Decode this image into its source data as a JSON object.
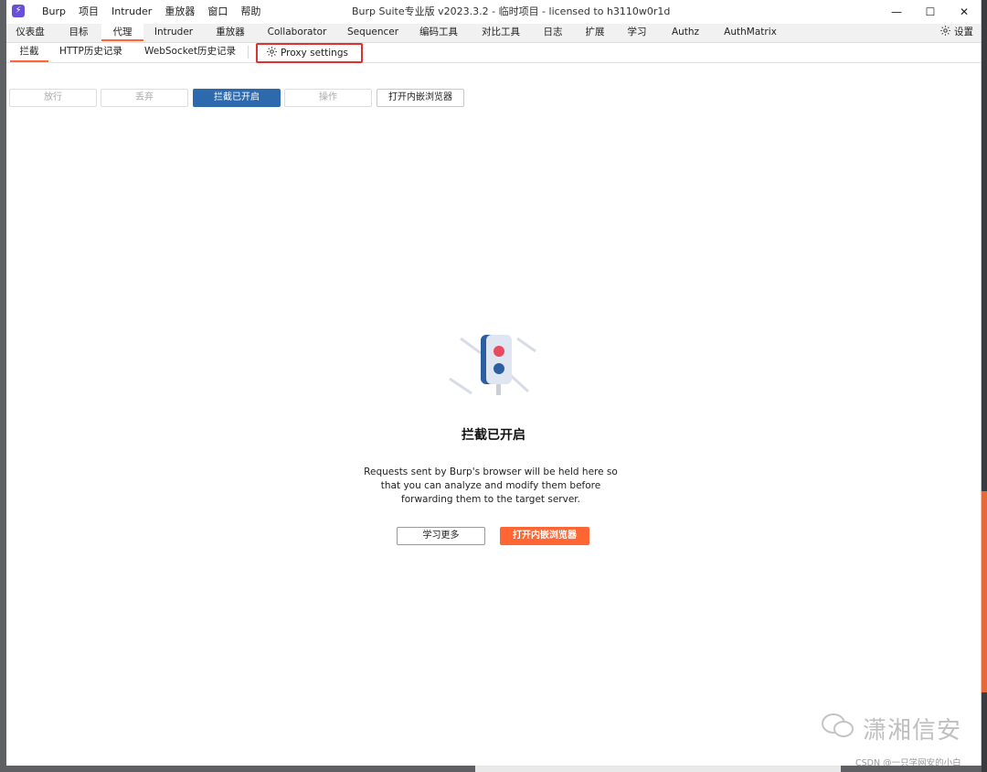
{
  "titlebar": {
    "app_icon_glyph": "⚡",
    "menu": [
      "Burp",
      "项目",
      "Intruder",
      "重放器",
      "窗口",
      "帮助"
    ],
    "window_title": "Burp Suite专业版  v2023.3.2 - 临时项目 - licensed to h3110w0r1d",
    "controls": [
      "—",
      "☐",
      "✕"
    ]
  },
  "tabs": {
    "items": [
      "仪表盘",
      "目标",
      "代理",
      "Intruder",
      "重放器",
      "Collaborator",
      "Sequencer",
      "编码工具",
      "对比工具",
      "日志",
      "扩展",
      "学习",
      "Authz",
      "AuthMatrix"
    ],
    "active_index": 2,
    "settings_label": "设置",
    "settings_icon": "gear-icon"
  },
  "subtabs": {
    "items": [
      "拦截",
      "HTTP历史记录",
      "WebSocket历史记录"
    ],
    "active_index": 0,
    "proxy_settings_label": "Proxy settings",
    "proxy_settings_icon": "gear-icon"
  },
  "toolbar": {
    "forward": "放行",
    "drop": "丢弃",
    "intercept_on": "拦截已开启",
    "action": "操作",
    "open_browser": "打开内嵌浏览器"
  },
  "empty_state": {
    "illustration": "traffic-light-icon",
    "title": "拦截已开启",
    "description": "Requests sent by Burp's browser will be held here so that you can analyze and modify them before forwarding them to the target server.",
    "learn_more": "学习更多",
    "open_browser": "打开内嵌浏览器"
  },
  "watermark": {
    "text": "潇湘信安",
    "csdn": "CSDN @一只学网安的小白"
  },
  "colors": {
    "accent_orange": "#ff6633",
    "primary_blue": "#2d6aad",
    "highlight_red": "#e03030"
  }
}
